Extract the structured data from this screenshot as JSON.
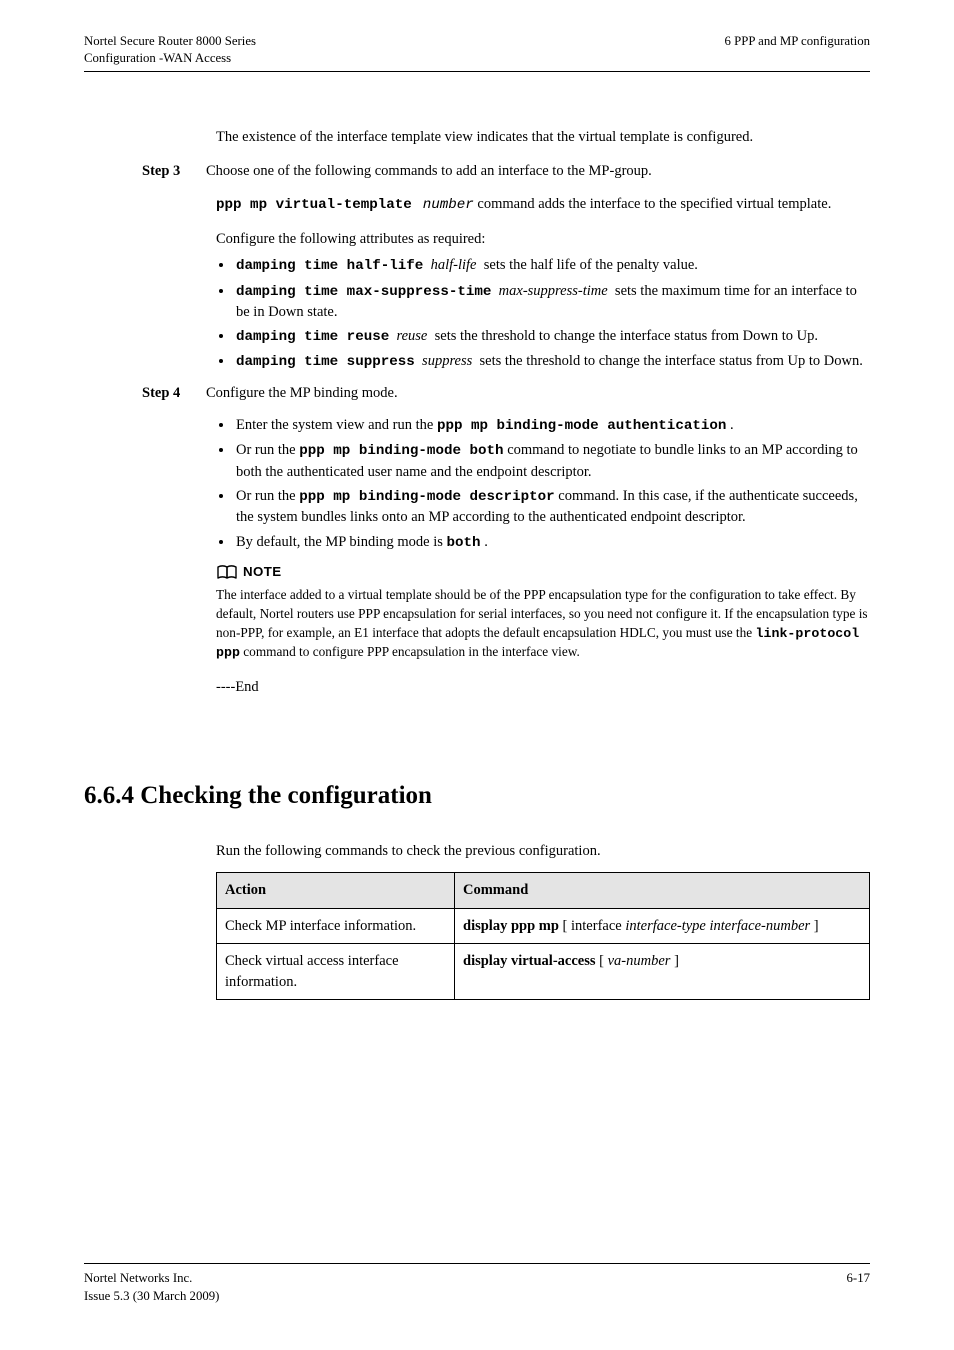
{
  "header": {
    "left_line1": "Nortel Secure Router 8000 Series",
    "left_line2": "Configuration -WAN Access",
    "right_line1": "",
    "right_line2": "6 PPP and MP configuration"
  },
  "body": {
    "pre_step3": "The existence of the interface template view indicates that the virtual template is configured.",
    "step3_label": "Step 3",
    "step3_text": "Choose one of the following commands to add an interface to the MP-group.",
    "step3_after_1_prefix_bold": "ppp mp virtual-template",
    "step3_after_1_prefix_italic": "number",
    "step3_after_1_suffix": " command adds the interface to the specified virtual template.",
    "step3_after_2": "Configure the following attributes as required:",
    "step3_bullets": [
      {
        "prefix_bold": "damping time half-life",
        "prefix_italic": "half-life",
        "tail": "sets the half life of the penalty value."
      },
      {
        "prefix_bold": "damping time max-suppress-time",
        "prefix_italic": "max-suppress-time",
        "tail": "sets the maximum time for an interface to be in Down state."
      },
      {
        "prefix_bold": "damping time reuse",
        "prefix_italic": "reuse",
        "tail": "sets the threshold to change the interface status from Down to Up."
      },
      {
        "prefix_bold": "damping time suppress",
        "prefix_italic": "suppress",
        "tail": "sets the threshold to change the interface status from Up to Down."
      }
    ],
    "step4_label": "Step 4",
    "step4_text": "Configure the MP binding mode.",
    "step4_bullets": [
      {
        "text_before_bold": "Enter the system view and run the ",
        "bold": "ppp mp binding-mode authentication",
        "text_after_bold": "."
      },
      {
        "text_before_bold": "Or run the ",
        "bold": "ppp mp binding-mode both",
        "text_after_bold": " command to negotiate to bundle links to an MP according to both the authenticated user name and the endpoint descriptor."
      },
      {
        "text_before_bold": "Or run the ",
        "bold": "ppp mp binding-mode descriptor",
        "text_after_bold": " command. In this case, if the authenticate succeeds, the system bundles links onto an MP according to the authenticated endpoint descriptor."
      },
      {
        "text_before_bold": "By default, the MP binding mode is ",
        "bold": "both",
        "text_after_bold": "."
      }
    ],
    "note_label": "NOTE",
    "note_text_before_bold": "The interface added to a virtual template should be of the PPP encapsulation type for the configuration to take effect. By default, Nortel routers use PPP encapsulation for serial interfaces, so you need not configure it. If the encapsulation type is non-PPP, for example, an E1 interface that adopts the default encapsulation HDLC, you must use the ",
    "note_bold": "link-protocol ppp",
    "note_text_after_bold": " command to configure PPP encapsulation in the interface view.",
    "end": "----End"
  },
  "section": {
    "heading": "6.6.4 Checking the configuration",
    "lead": "Run the following commands to check the previous configuration.",
    "table": {
      "headers": {
        "action": "Action",
        "command": "Command"
      },
      "rows": [
        {
          "action": "Check MP interface information.",
          "cmd_bold": "display ppp mp",
          "cmd_tail": " [ interface ",
          "cmd_italic": "interface-type interface-number",
          "cmd_close": " ]"
        },
        {
          "action": "Check virtual access interface information.",
          "cmd_bold": "display virtual-access",
          "cmd_tail": " [ ",
          "cmd_italic": "va-number",
          "cmd_close": " ]"
        }
      ]
    }
  },
  "footer": {
    "left_line1": "Nortel Networks Inc.",
    "left_line2": "Issue 5.3 (30 March 2009)",
    "right": "6-17"
  }
}
